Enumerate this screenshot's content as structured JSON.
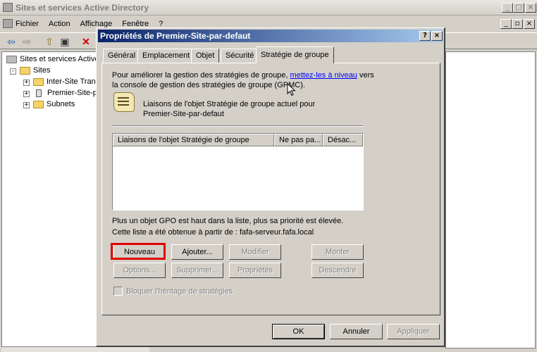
{
  "main_window": {
    "title": "Sites et services Active Directory",
    "controls": [
      "_",
      "□",
      "×"
    ],
    "menu": [
      {
        "label": "Fichier"
      },
      {
        "label": "Action"
      },
      {
        "label": "Affichage"
      },
      {
        "label": "Fenêtre"
      },
      {
        "label": "?"
      }
    ],
    "inner_controls": [
      "_",
      "▫",
      "×"
    ]
  },
  "tree": {
    "root": "Sites et services Active Directory",
    "sites": "Sites",
    "children": [
      {
        "label": "Inter-Site Transports"
      },
      {
        "label": "Premier-Site-par-defaut"
      },
      {
        "label": "Subnets"
      }
    ]
  },
  "dialog": {
    "title": "Propriétés de Premier-Site-par-defaut",
    "help_button": "?",
    "close_button": "×",
    "tabs": [
      {
        "label": "Général"
      },
      {
        "label": "Emplacement"
      },
      {
        "label": "Objet"
      },
      {
        "label": "Sécurité"
      },
      {
        "label": "Stratégie de groupe"
      }
    ],
    "intro_prefix": "Pour améliorer la gestion des stratégies de groupe,",
    "intro_link": "mettez-les à niveau",
    "intro_suffix": "vers",
    "intro_line2": "la console de gestion des stratégies de groupe (GPMC).",
    "links_title_1": "Liaisons de l'objet Stratégie de groupe actuel pour",
    "links_title_2": "Premier-Site-par-defaut",
    "list_columns": [
      {
        "label": "Liaisons de l'objet Stratégie de groupe"
      },
      {
        "label": "Ne pas pa..."
      },
      {
        "label": "Désac..."
      }
    ],
    "priority_note": "Plus un objet GPO est haut dans la liste, plus sa priorité est élevée.",
    "source_note": "Cette liste a été obtenue à partir de : fafa-serveur.fafa.local",
    "buttons_row1": {
      "new": "Nouveau",
      "add": "Ajouter...",
      "edit": "Modifier",
      "up": "Monter"
    },
    "buttons_row2": {
      "options": "Options...",
      "delete": "Supprimer...",
      "properties": "Propriétés",
      "down": "Descendre"
    },
    "block_inheritance_label": "Bloquer l'héritage de stratégies",
    "block_inheritance_checked": false,
    "footer": {
      "ok": "OK",
      "cancel": "Annuler",
      "apply": "Appliquer"
    }
  },
  "colors": {
    "highlight": "#e00000",
    "title_active": "#0a246a",
    "link": "#0000ff"
  },
  "icons": {
    "toolbar": [
      "back-arrow-icon",
      "forward-arrow-icon",
      "up-folder-icon",
      "show-tree-icon",
      "delete-icon"
    ]
  }
}
